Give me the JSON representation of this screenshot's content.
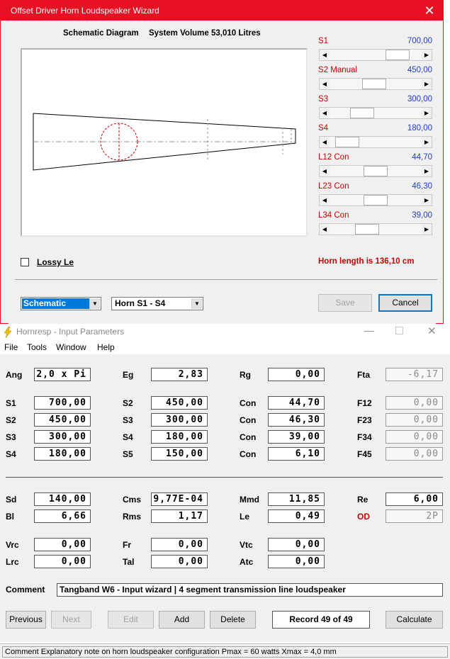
{
  "wizard": {
    "title": "Offset Driver Horn Loudspeaker Wizard",
    "close": "✕",
    "schematic_label": "Schematic Diagram",
    "volume_label": "System Volume 53,010 Litres",
    "sliders": [
      {
        "label": "S1",
        "value": "700,00",
        "pos": 0.82
      },
      {
        "label": "S2  Manual",
        "value": "450,00",
        "pos": 0.48
      },
      {
        "label": "S3",
        "value": "300,00",
        "pos": 0.3
      },
      {
        "label": "S4",
        "value": "180,00",
        "pos": 0.08
      },
      {
        "label": "L12  Con",
        "value": "44,70",
        "pos": 0.5
      },
      {
        "label": "L23  Con",
        "value": "46,30",
        "pos": 0.5
      },
      {
        "label": "L34  Con",
        "value": "39,00",
        "pos": 0.38
      }
    ],
    "lossy_label": "Lossy Le",
    "horn_length": "Horn length is 136,10 cm",
    "combo1": "Schematic",
    "combo2": "Horn S1 - S4",
    "save": "Save",
    "cancel": "Cancel"
  },
  "hornresp": {
    "title": "Hornresp - Input Parameters",
    "menu": [
      "File",
      "Tools",
      "Window",
      "Help"
    ]
  },
  "fields": {
    "Ang": "2,0 x Pi",
    "Eg": "2,83",
    "Rg": "0,00",
    "Fta": "-6,17",
    "S1": "700,00",
    "S2": "450,00",
    "Con1": "44,70",
    "F12": "0,00",
    "S2b": "450,00",
    "S3": "300,00",
    "Con2": "46,30",
    "F23": "0,00",
    "S3b": "300,00",
    "S4": "180,00",
    "Con3": "39,00",
    "F34": "0,00",
    "S4b": "180,00",
    "S5": "150,00",
    "Con4": "6,10",
    "F45": "0,00",
    "Sd": "140,00",
    "Cms": "9,77E-04",
    "Mmd": "11,85",
    "Re": "6,00",
    "Bl": "6,66",
    "Rms": "1,17",
    "Le": "0,49",
    "OD": "2P",
    "Vrc": "0,00",
    "Fr": "0,00",
    "Vtc": "0,00",
    "Lrc": "0,00",
    "Tal": "0,00",
    "Atc": "0,00"
  },
  "labels": {
    "Ang": "Ang",
    "Eg": "Eg",
    "Rg": "Rg",
    "Fta": "Fta",
    "S1": "S1",
    "S2": "S2",
    "S3": "S3",
    "S4": "S4",
    "S5": "S5",
    "Con": "Con",
    "F12": "F12",
    "F23": "F23",
    "F34": "F34",
    "F45": "F45",
    "Sd": "Sd",
    "Cms": "Cms",
    "Mmd": "Mmd",
    "Re": "Re",
    "Bl": "Bl",
    "Rms": "Rms",
    "Le": "Le",
    "OD": "OD",
    "Vrc": "Vrc",
    "Fr": "Fr",
    "Vtc": "Vtc",
    "Lrc": "Lrc",
    "Tal": "Tal",
    "Atc": "Atc",
    "Comment": "Comment"
  },
  "comment": "Tangband W6 - Input wizard | 4 segment transmission line loudspeaker",
  "buttons": {
    "previous": "Previous",
    "next": "Next",
    "edit": "Edit",
    "add": "Add",
    "delete": "Delete",
    "record": "Record 49 of 49",
    "calculate": "Calculate"
  },
  "status": "Comment   Explanatory note on horn loudspeaker configuration   Pmax = 60 watts   Xmax = 4,0 mm"
}
